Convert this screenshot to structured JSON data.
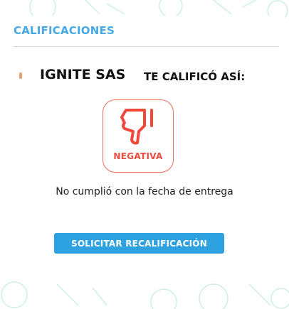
{
  "section_title": "CALIFICACIONES",
  "rater_name": "IGNITE SAS",
  "rated_text": "TE CALIFICÓ ASÍ:",
  "rating": {
    "label": "NEGATIVA",
    "icon": "thumbs-down-icon",
    "color": "#f0493c"
  },
  "reason": "No cumplió con la fecha de entrega",
  "request_button": "SOLICITAR RECALIFICACIÓN",
  "colors": {
    "accent": "#2ea2e1",
    "title": "#45a9e6"
  }
}
